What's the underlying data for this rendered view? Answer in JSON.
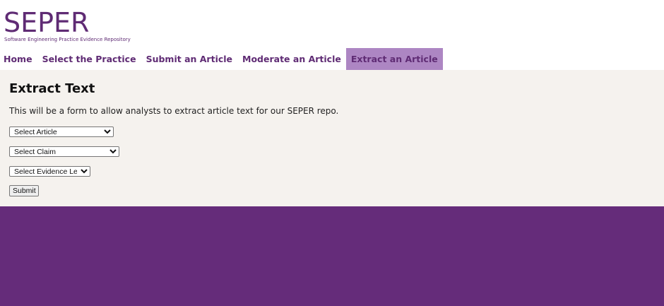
{
  "header": {
    "logo_title": "SEPER",
    "logo_subtitle": "Software Engineering Practice Evidence Repository"
  },
  "nav": {
    "items": [
      {
        "label": "Home",
        "active": false
      },
      {
        "label": "Select the Practice",
        "active": false
      },
      {
        "label": "Submit an Article",
        "active": false
      },
      {
        "label": "Moderate an Article",
        "active": false
      },
      {
        "label": "Extract an Article",
        "active": true
      }
    ]
  },
  "main": {
    "title": "Extract Text",
    "intro": "This will be a form to allow analysts to extract article text for our SEPER repo.",
    "article_select": "Select Article",
    "claim_select": "Select Claim",
    "evidence_select": "Select Evidence Level",
    "submit_label": "Submit"
  },
  "colors": {
    "brand": "#5f2b74",
    "active_tab": "#ad86c3",
    "content_bg": "#f5f2ee",
    "footer_bg": "#652c7a"
  }
}
